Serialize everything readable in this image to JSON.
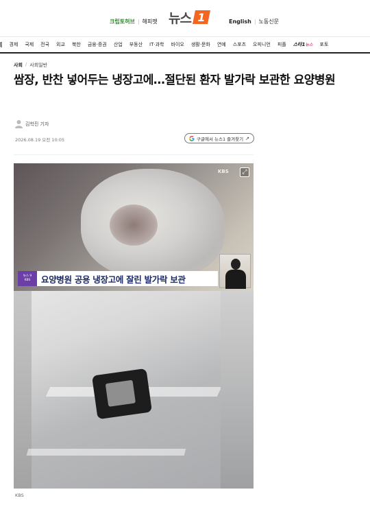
{
  "header": {
    "left_links": [
      "크립토허브",
      "해피펫"
    ],
    "logo_text": "뉴스",
    "logo_number": "1",
    "right_links": [
      "English",
      "노동신문"
    ]
  },
  "nav": {
    "items": [
      "회",
      "경제",
      "국제",
      "전국",
      "외교",
      "북한",
      "금융·증권",
      "산업",
      "부동산",
      "IT·과학",
      "바이오",
      "생활·문화",
      "연예",
      "스포츠",
      "오피니언",
      "피플"
    ],
    "star": "스타1",
    "star_suffix": "뉴스",
    "last": "포토"
  },
  "article": {
    "breadcrumb": [
      "사회",
      "사회일반"
    ],
    "title": "쌈장, 반찬 넣어두는 냉장고에…절단된 환자 발가락 보관한 요양병원",
    "author": "김학진 기자",
    "date": "2026.08.19 오전 10:05",
    "google_button": "구글에서 뉴스1 즐겨찾기"
  },
  "photo": {
    "watermark": "KBS",
    "caption_logo_line1": "뉴스 9",
    "caption_logo_line2": "KBS",
    "caption": "요양병원 공용 냉장고에 잘린 발가락 보관",
    "credit": "KBS"
  },
  "colors": {
    "accent_orange": "#f26522",
    "green": "#2f8a2a",
    "caption_navy": "#1c2b63",
    "caption_purple": "#6c3fa6"
  }
}
